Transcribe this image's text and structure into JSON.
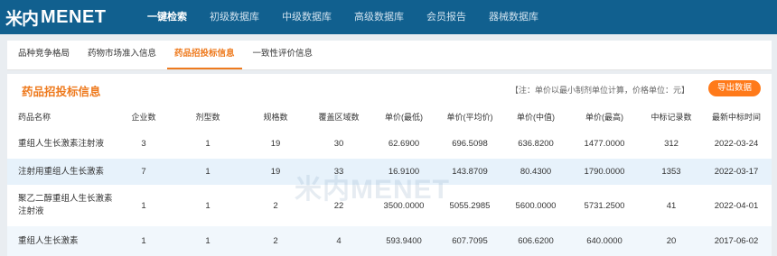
{
  "brand": {
    "mark": "米内",
    "name": "MENET"
  },
  "nav": [
    "一键检索",
    "初级数据库",
    "中级数据库",
    "高级数据库",
    "会员报告",
    "器械数据库"
  ],
  "subtabs": [
    "品种竞争格局",
    "药物市场准入信息",
    "药品招投标信息",
    "一致性评价信息"
  ],
  "panel": {
    "title": "药品招投标信息",
    "note": "【注：单价以最小制剂单位计算，价格单位：元】",
    "export_label": "导出数据",
    "watermark": "米内MENET"
  },
  "table": {
    "headers": [
      "药品名称",
      "企业数",
      "剂型数",
      "规格数",
      "覆盖区域数",
      "单价(最低)",
      "单价(平均价)",
      "单价(中值)",
      "单价(最高)",
      "中标记录数",
      "最新中标时间"
    ],
    "rows": [
      [
        "重组人生长激素注射液",
        "3",
        "1",
        "19",
        "30",
        "62.6900",
        "696.5098",
        "636.8200",
        "1477.0000",
        "312",
        "2022-03-24"
      ],
      [
        "注射用重组人生长激素",
        "7",
        "1",
        "19",
        "33",
        "16.9100",
        "143.8709",
        "80.4300",
        "1790.0000",
        "1353",
        "2022-03-17"
      ],
      [
        "聚乙二醇重组人生长激素注射液",
        "1",
        "1",
        "2",
        "22",
        "3500.0000",
        "5055.2985",
        "5600.0000",
        "5731.2500",
        "41",
        "2022-04-01"
      ],
      [
        "重组人生长激素",
        "1",
        "1",
        "2",
        "4",
        "593.9400",
        "607.7095",
        "606.6200",
        "640.0000",
        "20",
        "2017-06-02"
      ]
    ]
  },
  "colors": {
    "topbar": "#11608f",
    "accent": "#ee7a1e",
    "export_button": "#ff7a1a",
    "row_highlight": "#e7f2fb"
  }
}
